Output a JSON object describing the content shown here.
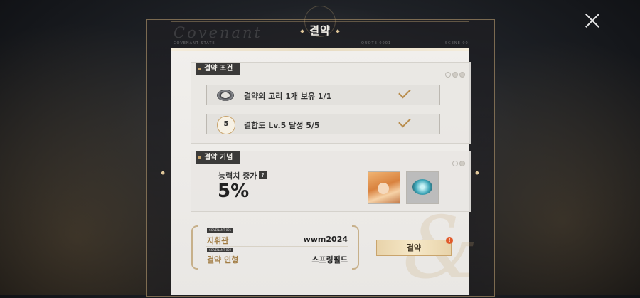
{
  "header": {
    "title": "결약",
    "bg_word": "Covenant",
    "band_labels": [
      "COVENANT STATE",
      "QUOTE 0001",
      "SCENE 00"
    ]
  },
  "conditions": {
    "section_title": "결약 조건",
    "items": [
      {
        "icon": "ring-icon",
        "text": "결약의 고리 1개 보유 1/1",
        "done": true
      },
      {
        "icon": "level-5-icon",
        "icon_text": "5",
        "text": "결합도 Lv.5 달성 5/5",
        "done": true
      }
    ]
  },
  "commemoration": {
    "section_title": "결약 기념",
    "stat_label": "능력치 증가",
    "help_badge": "?",
    "stat_value": "5%",
    "rewards": [
      "character-portrait-icon",
      "covenant-badge-icon"
    ]
  },
  "info": {
    "tag1": "COVENANT 001",
    "key1": "지휘관",
    "value1": "wwm2024",
    "tag2": "COVENANT 002",
    "key2": "결약 인형",
    "value2": "스프링필드"
  },
  "actions": {
    "covenant_button": "결약",
    "alert_badge": "!"
  },
  "colors": {
    "accent_gold": "#c9a46c",
    "dark_tag": "#3b3a39",
    "alert": "#e15a2b"
  }
}
